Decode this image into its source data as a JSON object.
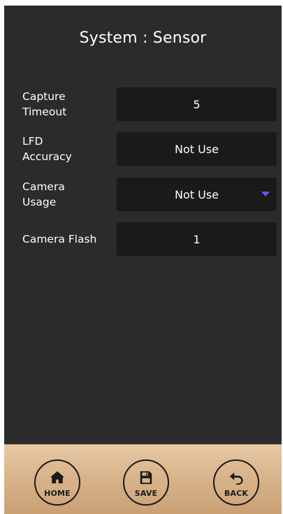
{
  "header": {
    "title": "System : Sensor"
  },
  "settings": [
    {
      "label_line1": "Capture",
      "label_line2": "Timeout",
      "value": "5",
      "has_dropdown": false
    },
    {
      "label_line1": "LFD",
      "label_line2": "Accuracy",
      "value": "Not Use",
      "has_dropdown": false
    },
    {
      "label_line1": "Camera",
      "label_line2": "Usage",
      "value": "Not Use",
      "has_dropdown": true
    },
    {
      "label_line1": "Camera Flash",
      "label_line2": "",
      "value": "1",
      "has_dropdown": false
    }
  ],
  "footer": {
    "home_label": "HOME",
    "save_label": "SAVE",
    "back_label": "BACK",
    "home_icon": "home-icon",
    "save_icon": "save-icon",
    "back_icon": "back-arrow-icon"
  },
  "colors": {
    "background": "#2b2b2b",
    "field_background": "#1a1a1a",
    "dropdown_arrow": "#5b5bf0",
    "footer_background": "#d4ae84"
  }
}
